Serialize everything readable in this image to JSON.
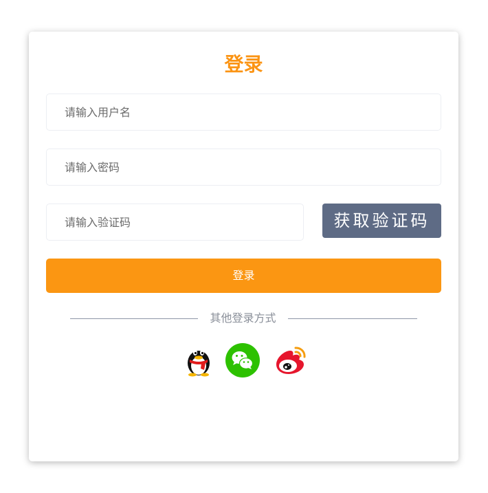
{
  "login": {
    "title": "登录",
    "username_placeholder": "请输入用户名",
    "password_placeholder": "请输入密码",
    "code_placeholder": "请输入验证码",
    "captcha_label": "获取验证码",
    "submit_label": "登录",
    "other_methods_label": "其他登录方式"
  },
  "social": [
    {
      "icon": "qq-icon"
    },
    {
      "icon": "wechat-icon"
    },
    {
      "icon": "weibo-icon"
    }
  ],
  "colors": {
    "accent": "#fb9612",
    "captcha_bg": "#5e6b85",
    "wechat": "#2dc100",
    "weibo": "#e6162d"
  }
}
